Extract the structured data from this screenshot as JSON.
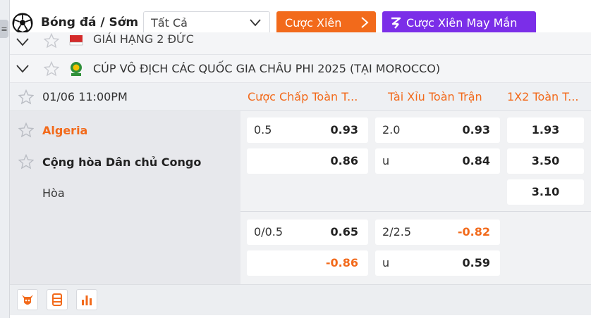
{
  "header": {
    "sport_title": "Bóng đá / Sớm",
    "filter_value": "Tất Cả",
    "parlay_label": "Cược Xiên",
    "lucky_parlay_label": "Cược Xiên May Mắn"
  },
  "leagues": [
    {
      "name": "GIẢI HẠNG 2 ĐỨC"
    },
    {
      "name": "CÚP VÔ ĐỊCH CÁC QUỐC GIA CHÂU PHI 2025 (TẠI MOROCCO)"
    }
  ],
  "match": {
    "time": "01/06 11:00PM",
    "columns": {
      "handicap": "Cược Chấp Toàn T...",
      "over_under": "Tài Xỉu Toàn Trận",
      "one_x_two": "1X2 Toàn T..."
    },
    "home_team": "Algeria",
    "away_team": "Cộng hòa Dân chủ Congo",
    "draw_label": "Hòa",
    "markets": [
      {
        "handicap": {
          "home_line": "0.5",
          "home_odd": "0.93",
          "away_line": "",
          "away_odd": "0.86"
        },
        "over_under": {
          "over_line": "2.0",
          "over_odd": "0.93",
          "under_line": "u",
          "under_odd": "0.84"
        },
        "one_x_two": {
          "home": "1.93",
          "away": "3.50",
          "draw": "3.10"
        }
      },
      {
        "handicap": {
          "home_line": "0/0.5",
          "home_odd": "0.65",
          "away_line": "",
          "away_odd": "-0.86"
        },
        "over_under": {
          "over_line": "2/2.5",
          "over_odd": "-0.82",
          "under_line": "u",
          "under_odd": "0.59"
        }
      }
    ]
  },
  "footer": {
    "icons": [
      "bull-icon",
      "scoreboard-icon",
      "stats-icon"
    ]
  },
  "colors": {
    "accent": "#f26a1b",
    "lucky": "#7b2ee8"
  }
}
